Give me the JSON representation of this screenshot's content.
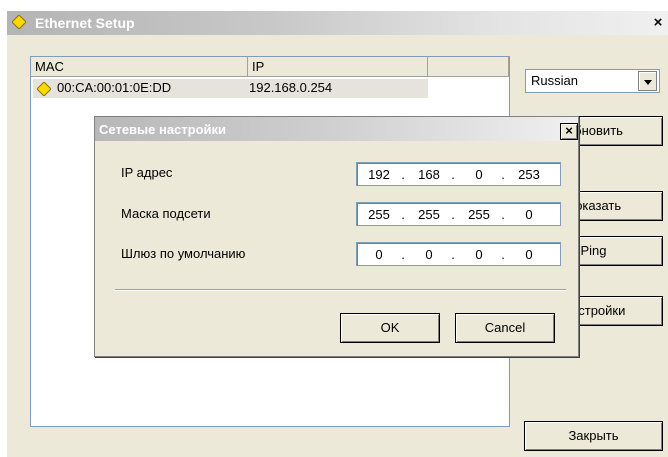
{
  "main_window": {
    "title": "Ethernet Setup",
    "close_glyph": "×",
    "list": {
      "columns": [
        "MAC",
        "IP",
        ""
      ],
      "rows": [
        {
          "mac": "00:CA:00:01:0E:DD",
          "ip": "192.168.0.254",
          "icon": "diamond-icon"
        }
      ]
    },
    "language": {
      "selected": "Russian"
    },
    "buttons": {
      "update": "Обновить",
      "show": "Показать",
      "ping": "Ping",
      "settings": "Настройки",
      "close": "Закрыть"
    }
  },
  "dialog": {
    "title": "Сетевые настройки",
    "close_glyph": "×",
    "fields": {
      "ip": {
        "label": "IP адрес",
        "octets": [
          "192",
          "168",
          "0",
          "253"
        ]
      },
      "mask": {
        "label": "Маска подсети",
        "octets": [
          "255",
          "255",
          "255",
          "0"
        ]
      },
      "gateway": {
        "label": "Шлюз по умолчанию",
        "octets": [
          "0",
          "0",
          "0",
          "0"
        ]
      }
    },
    "ok": "OK",
    "cancel": "Cancel"
  },
  "colors": {
    "icon_yellow": "#ffd800",
    "list_border": "#7f9db9",
    "face": "#ece9d8"
  }
}
